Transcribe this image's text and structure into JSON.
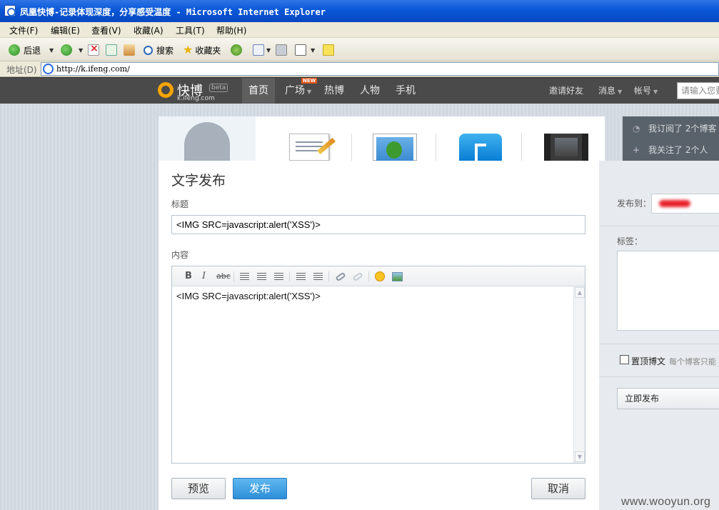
{
  "window": {
    "title": "凤凰快博-记录体现深度，分享感受温度 - Microsoft Internet Explorer"
  },
  "menu": [
    "文件(F)",
    "编辑(E)",
    "查看(V)",
    "收藏(A)",
    "工具(T)",
    "帮助(H)"
  ],
  "toolbar": {
    "back": "后退",
    "search": "搜索",
    "favorites": "收藏夹"
  },
  "address": {
    "label": "地址(D)",
    "url": "http://k.ifeng.com/"
  },
  "site": {
    "logo_name": "快博",
    "logo_beta": "beta",
    "logo_domain": "k.ifeng.com",
    "nav": [
      "首页",
      "广场",
      "热博",
      "人物",
      "手机"
    ],
    "new_badge": "NEW",
    "invite": "邀请好友",
    "messages": "消息",
    "account": "帐号",
    "search_placeholder": "请输入您要"
  },
  "sidebar_info": {
    "subscribed": "我订阅了 2个博客",
    "following": "我关注了 2个人"
  },
  "post": {
    "heading": "文字发布",
    "title_label": "标题",
    "title_value": "<IMG SRC=javascript:alert('XSS')>",
    "content_label": "内容",
    "content_value": "<IMG SRC=javascript:alert('XSS')>",
    "preview": "预览",
    "publish": "发布",
    "cancel": "取消"
  },
  "publish_panel": {
    "publish_to_label": "发布到：",
    "publish_to_value": "chinsz",
    "tags_label": "标签：",
    "pin_label": "置顶博文",
    "pin_hint": "每个博客只能",
    "publish_now": "立即发布"
  },
  "watermark": "www.wooyun.org"
}
